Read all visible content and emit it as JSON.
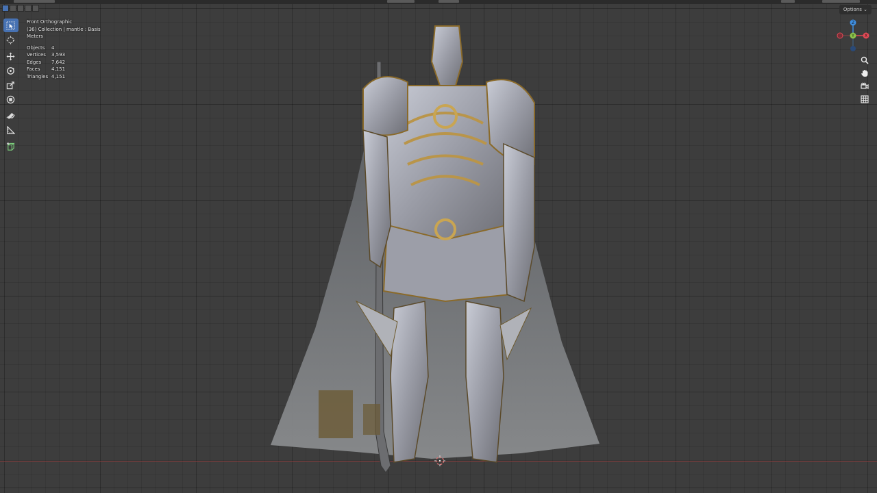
{
  "viewport": {
    "view_name": "Front Orthographic",
    "collection_line": "(36) Collection | mantle : Basis",
    "units": "Meters",
    "stats": [
      {
        "label": "Objects",
        "value": "4"
      },
      {
        "label": "Vertices",
        "value": "3,593"
      },
      {
        "label": "Edges",
        "value": "7,642"
      },
      {
        "label": "Faces",
        "value": "4,151"
      },
      {
        "label": "Triangles",
        "value": "4,151"
      }
    ],
    "options_label": "Options ⌄"
  },
  "gizmo": {
    "z_label": "Z",
    "y_label": "Y",
    "x_label": "X",
    "colors": {
      "x": "#e04a56",
      "y": "#8bc34a",
      "z": "#3f8fe0"
    }
  },
  "toolbar": {
    "tools": [
      "select-box-icon",
      "cursor-icon",
      "move-icon",
      "rotate-icon",
      "scale-icon",
      "transform-icon",
      "annotate-icon",
      "measure-icon",
      "add-cube-icon"
    ]
  },
  "navigation": {
    "buttons": [
      "zoom-icon",
      "hand-pan-icon",
      "camera-icon",
      "grid-icon"
    ]
  },
  "colors": {
    "viewport_bg": "#3d3d3d",
    "active_tool": "#4772b3",
    "x_axis_line": "#8a3b3b"
  }
}
